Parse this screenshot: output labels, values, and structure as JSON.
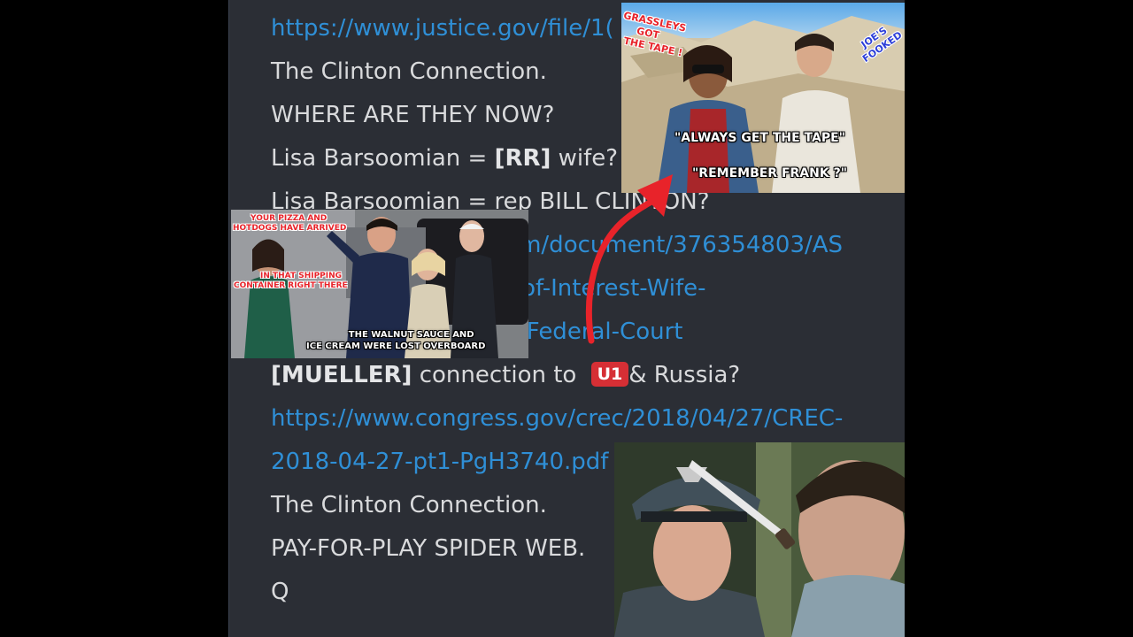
{
  "post": {
    "lines": [
      {
        "type": "link",
        "text": "https://www.justice.gov/file/1("
      },
      {
        "type": "text",
        "text": "The Clinton Connection."
      },
      {
        "type": "text",
        "text": "WHERE ARE THEY NOW?"
      },
      {
        "type": "mixed",
        "pre": "Lisa Barsoomian = ",
        "strong": "[RR]",
        "post": " wife?"
      },
      {
        "type": "text",
        "text": "Lisa Barsoomian = rep BILL CLINTON?"
      },
      {
        "type": "link",
        "text": "https://www.scribd.com/document/376354803/AS"
      },
      {
        "type": "link",
        "text": "Rosenstein-s-Conflict-of-Interest-Wife-"
      },
      {
        "type": "link",
        "text": "Represents-Clinton-in-Federal-Court"
      },
      {
        "type": "mueller",
        "strong": "[MUELLER]",
        "mid": " connection to ",
        "badge": "U1",
        "post": "& Russia?"
      },
      {
        "type": "link",
        "text": "https://www.congress.gov/crec/2018/04/27/CREC-"
      },
      {
        "type": "link",
        "text": "2018-04-27-pt1-PgH3740.pdf"
      },
      {
        "type": "text",
        "text": "The Clinton Connection."
      },
      {
        "type": "text",
        "text": "PAY-FOR-PLAY SPIDER WEB."
      },
      {
        "type": "text",
        "text": "Q"
      }
    ]
  },
  "meme_top": {
    "caption_left": [
      "GRASSLEYS",
      "GOT",
      "THE TAPE !"
    ],
    "caption_right": [
      "JOE'S",
      "FOOKED"
    ],
    "quote1": "\"ALWAYS GET THE TAPE\"",
    "quote2": "\"REMEMBER FRANK ?\""
  },
  "meme_left": {
    "top": [
      "YOUR PIZZA AND",
      "HOTDOGS HAVE ARRIVED"
    ],
    "middle": [
      "IN THAT SHIPPING",
      "CONTAINER RIGHT THERE"
    ],
    "bottom": [
      "THE WALNUT SAUCE AND",
      "ICE CREAM WERE LOST OVERBOARD"
    ]
  },
  "colors": {
    "panel": "#2b2e35",
    "link": "#2f8fd6",
    "text": "#d9dadc",
    "badge": "#d62f35",
    "arrow": "#e8232a"
  },
  "icons": [
    "red-arrow-icon"
  ]
}
